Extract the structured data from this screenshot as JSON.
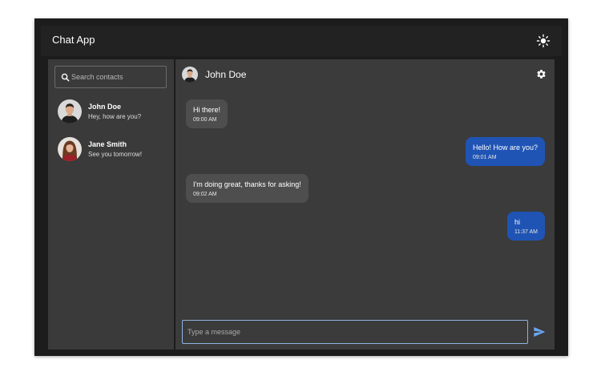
{
  "app": {
    "title": "Chat App"
  },
  "search": {
    "placeholder": "Search contacts"
  },
  "contacts": [
    {
      "name": "John Doe",
      "preview": "Hey, how are you?"
    },
    {
      "name": "Jane Smith",
      "preview": "See you tomorrow!"
    }
  ],
  "chat": {
    "contact_name": "John Doe",
    "messages": [
      {
        "direction": "incoming",
        "text": "Hi there!",
        "time": "09:00 AM"
      },
      {
        "direction": "outgoing",
        "text": "Hello! How are you?",
        "time": "09:01 AM"
      },
      {
        "direction": "incoming",
        "text": "I'm doing great, thanks for asking!",
        "time": "09:02 AM"
      },
      {
        "direction": "outgoing",
        "text": "hi",
        "time": "11:37 AM"
      }
    ]
  },
  "composer": {
    "placeholder": "Type a message"
  },
  "colors": {
    "outgoing_bubble": "#1f54b5",
    "incoming_bubble": "#4e4e4e",
    "send_icon": "#6aa8f5",
    "input_border": "#8fb4e0"
  },
  "icons": {
    "theme": "sun-icon",
    "search": "search-icon",
    "settings": "gear-icon",
    "send": "send-icon"
  }
}
